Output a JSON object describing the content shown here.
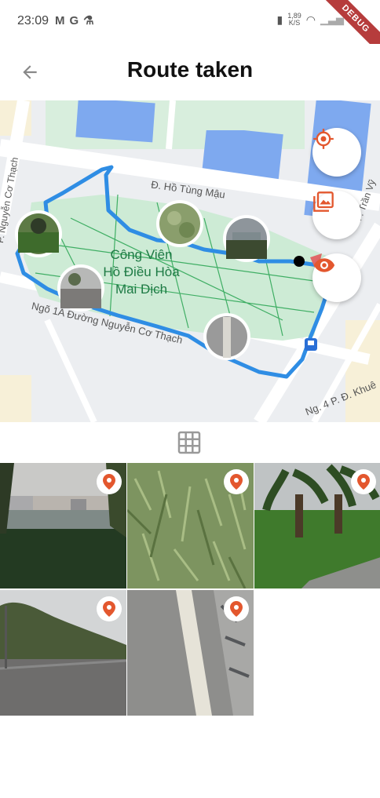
{
  "status_bar": {
    "time": "23:09",
    "left_icons": [
      "gmail-icon",
      "google-icon",
      "flask-icon"
    ],
    "net_speed": "1,89",
    "net_unit": "K/S",
    "debug_banner": "DEBUG"
  },
  "app_bar": {
    "title": "Route taken"
  },
  "map": {
    "street_labels": {
      "top": "Đ. Hồ Tùng Mậu",
      "left": "P. Nguyễn Cơ Thạch",
      "bottom": "Ngõ 1A Đường Nguyễn Cơ Thạch",
      "right_top": "P. Trần Vỹ",
      "bottom_right": "Ng. 4 P. Đ. Khuê"
    },
    "park_name_line1": "Công Viên",
    "park_name_line2": "Hồ Điều Hòa",
    "park_name_line3": "Mai Dịch",
    "buttons": [
      "my-location-icon",
      "gallery-icon",
      "eye-icon"
    ],
    "colors": {
      "route": "#2f8de4",
      "accent": "#e3572e",
      "park": "#cdebd5",
      "water": "#8ab4f8"
    }
  },
  "gallery": {
    "toggle_icon": "grid-icon",
    "photo_count": 5
  }
}
